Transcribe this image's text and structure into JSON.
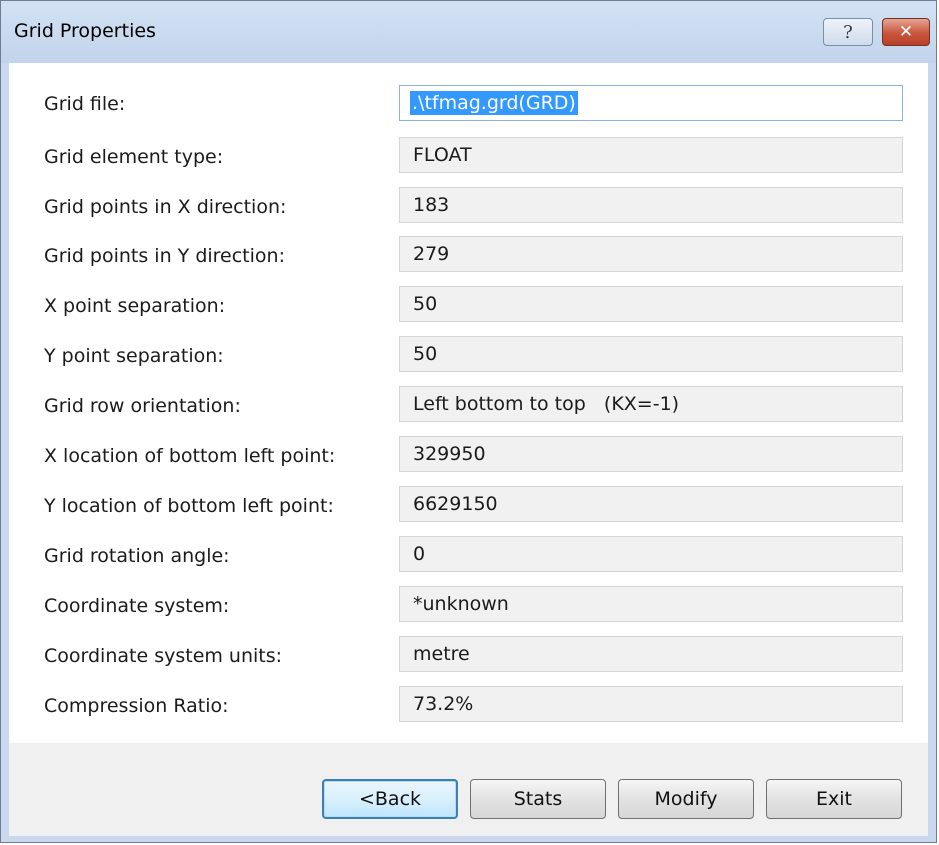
{
  "window": {
    "title": "Grid Properties",
    "help_glyph": "?",
    "close_glyph": "✕"
  },
  "properties": [
    {
      "label": "Grid file:",
      "value": ".\\tfmag.grd(GRD)"
    },
    {
      "label": "Grid element type:",
      "value": "FLOAT"
    },
    {
      "label": "Grid points in X direction:",
      "value": "183"
    },
    {
      "label": "Grid points in Y direction:",
      "value": "279"
    },
    {
      "label": "X point separation:",
      "value": "50"
    },
    {
      "label": "Y point separation:",
      "value": "50"
    },
    {
      "label": "Grid row orientation:",
      "value": "Left bottom to top   (KX=-1)"
    },
    {
      "label": "X location of bottom left point:",
      "value": "329950"
    },
    {
      "label": "Y location of bottom left point:",
      "value": "6629150"
    },
    {
      "label": "Grid rotation angle:",
      "value": "0"
    },
    {
      "label": "Coordinate system:",
      "value": "*unknown"
    },
    {
      "label": "Coordinate system units:",
      "value": "metre"
    },
    {
      "label": "Compression Ratio:",
      "value": "73.2%"
    }
  ],
  "buttons": {
    "back": "<Back",
    "stats": "Stats",
    "modify": "Modify",
    "exit": "Exit"
  },
  "colors": {
    "selection": "#3399ff",
    "close_button": "#c9553b",
    "default_button_border": "#3c7fb1"
  },
  "icons": {
    "help": "question-mark",
    "close": "x-mark"
  }
}
